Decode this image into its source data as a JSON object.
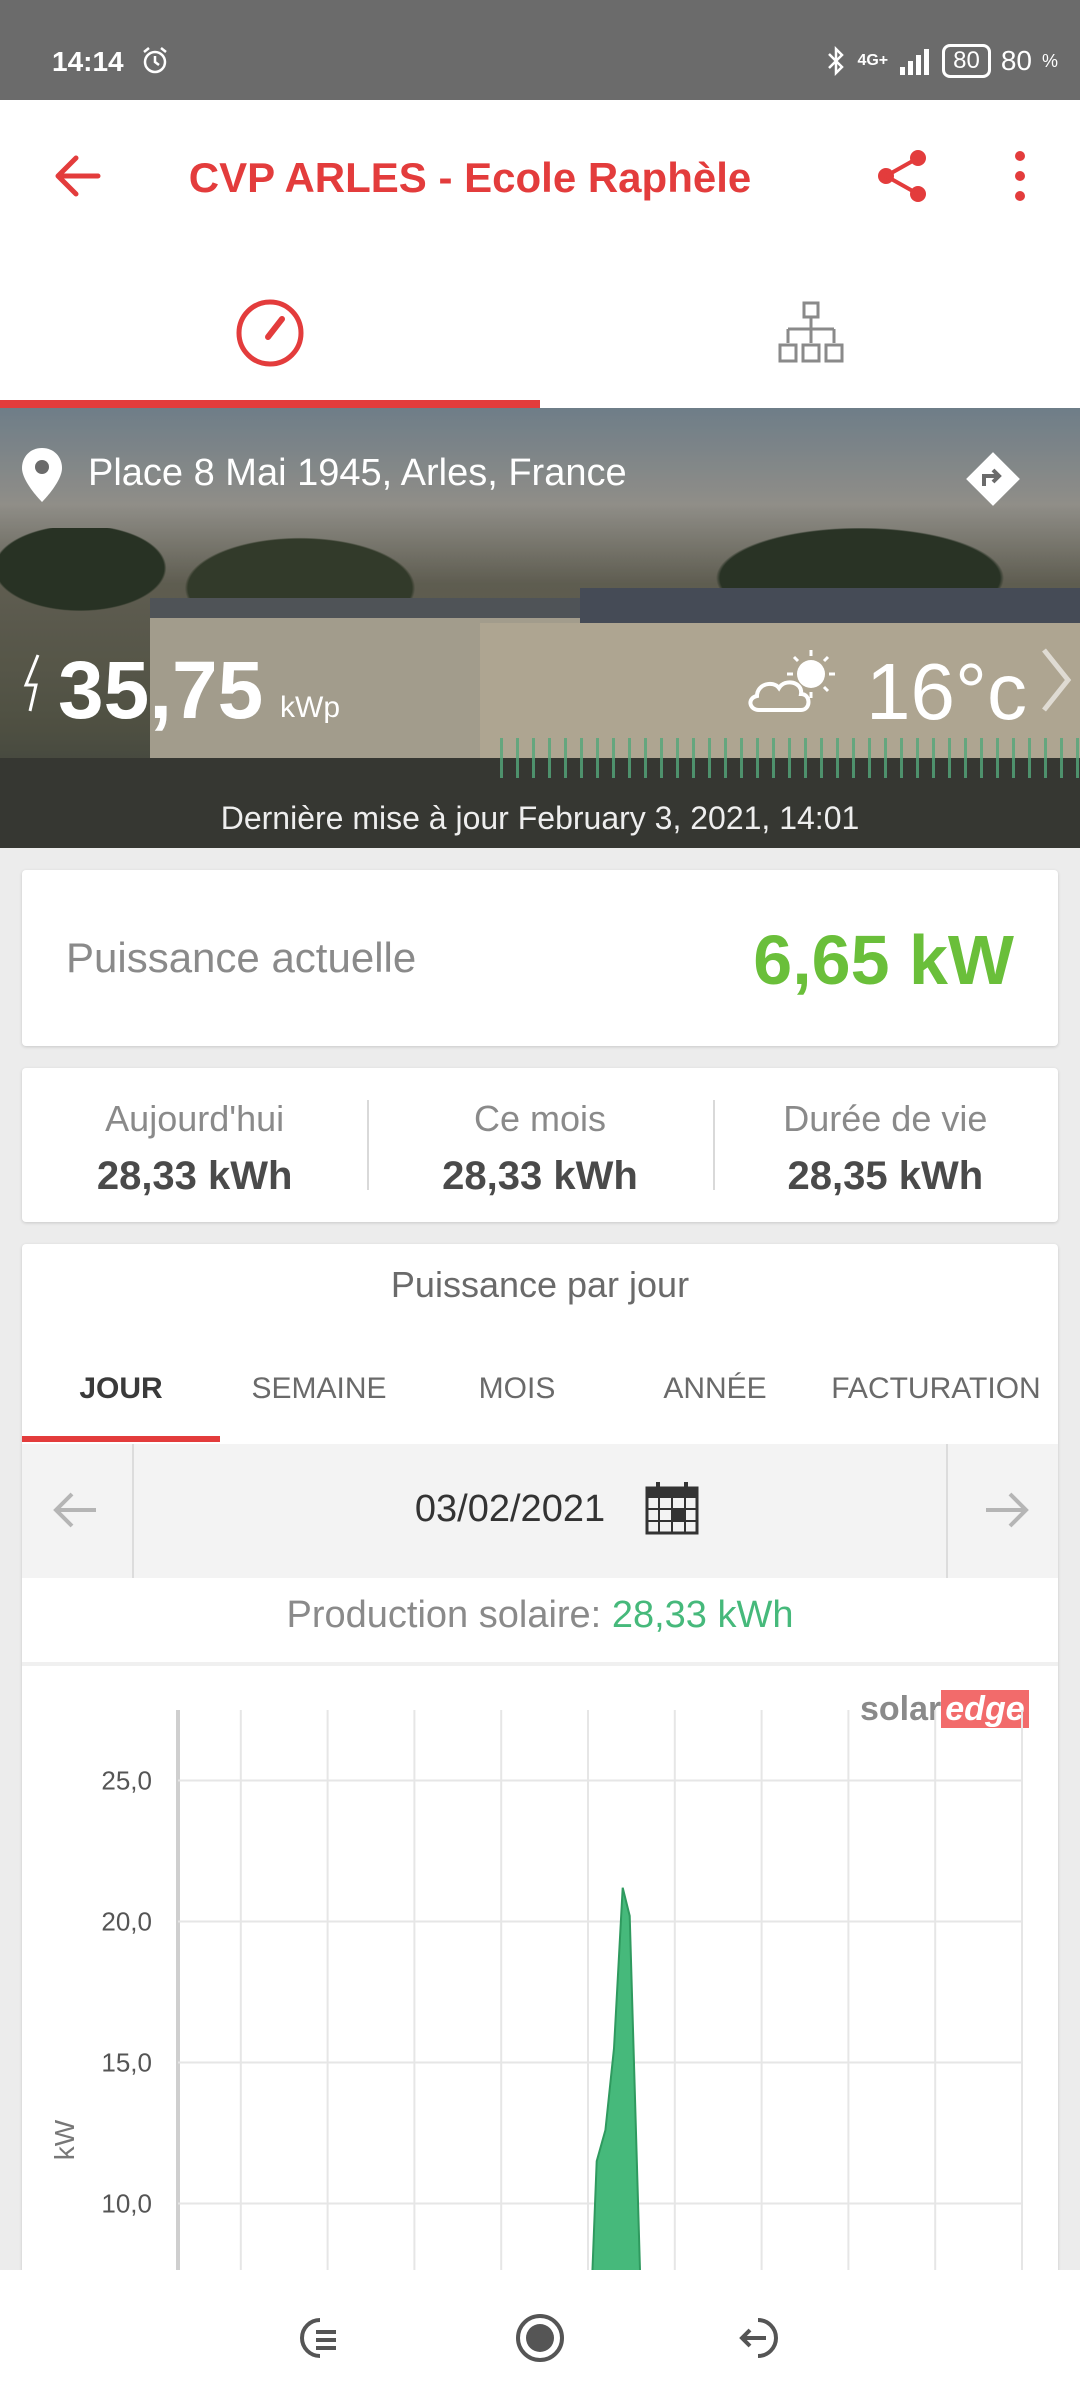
{
  "status_bar": {
    "time": "14:14",
    "network": "4G+",
    "battery": "80",
    "battery_text": "80",
    "battery_pct": "%"
  },
  "app_bar": {
    "title": "CVP ARLES - Ecole Raphèle"
  },
  "hero": {
    "location": "Place 8 Mai 1945, Arles, France",
    "peak_power": "35,75",
    "peak_unit": "kWp",
    "temperature": "16°c",
    "last_update": "Dernière mise à jour February 3, 2021, 14:01"
  },
  "current_power": {
    "label": "Puissance actuelle",
    "value": "6,65 kW"
  },
  "stats": [
    {
      "label": "Aujourd'hui",
      "value": "28,33 kWh"
    },
    {
      "label": "Ce mois",
      "value": "28,33 kWh"
    },
    {
      "label": "Durée de vie",
      "value": "28,35 kWh"
    }
  ],
  "chart_section": {
    "title": "Puissance par jour",
    "periods": [
      "JOUR",
      "SEMAINE",
      "MOIS",
      "ANNÉE",
      "FACTURATION"
    ],
    "active_period": "JOUR",
    "date": "03/02/2021",
    "production_label": "Production solaire:",
    "production_value": "28,33 kWh",
    "logo_solar": "solar",
    "logo_edge": "edge"
  },
  "chart_data": {
    "type": "area",
    "ylabel": "kW",
    "yticks": [
      "25,0",
      "20,0",
      "15,0",
      "10,0"
    ],
    "ytick_values": [
      25,
      20,
      15,
      10
    ],
    "ylim": [
      7.5,
      27.5
    ],
    "x": [
      0,
      1,
      2,
      3,
      4,
      5,
      6,
      7,
      8,
      9,
      10
    ],
    "x_partial": [
      5.05,
      5.1,
      5.2,
      5.3,
      5.4,
      5.48,
      5.6
    ],
    "values": [
      7.5,
      11.5,
      12.6,
      15.5,
      21.2,
      20.2,
      7.5
    ],
    "color": "#46b97b",
    "grid": true
  },
  "colors": {
    "accent": "#e33c3c",
    "positive": "#6abf3a",
    "chart": "#46b97b"
  }
}
